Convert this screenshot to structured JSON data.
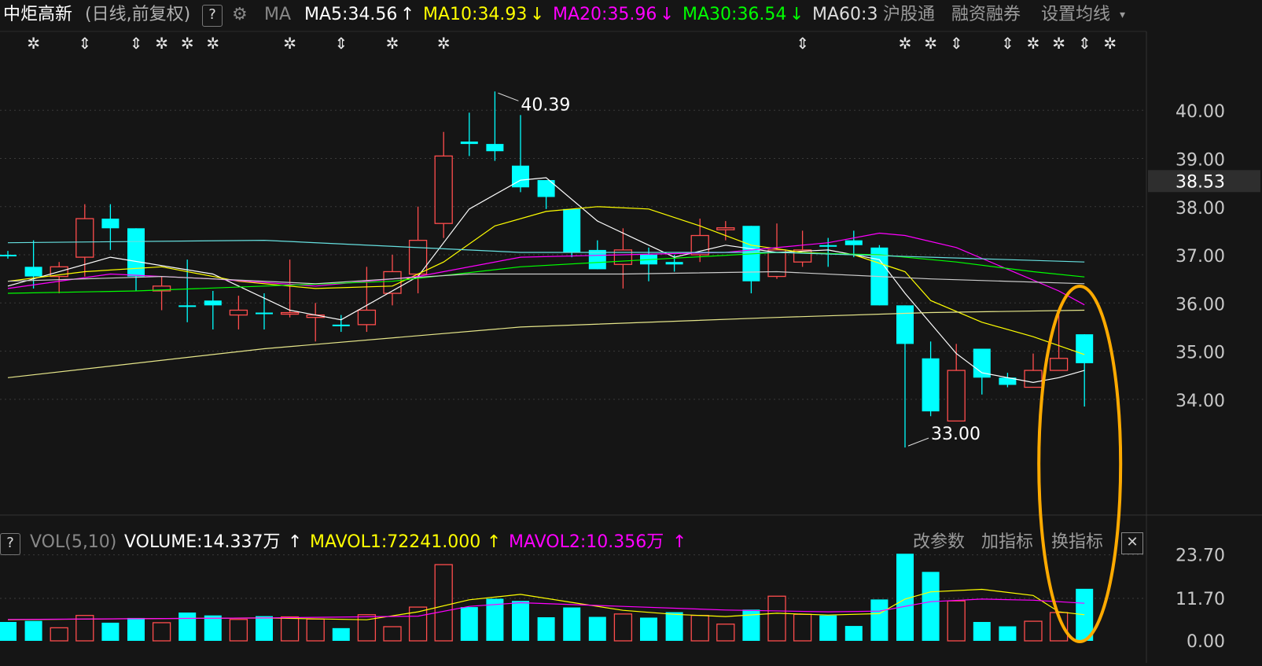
{
  "header": {
    "stock_name": "中炬高新",
    "period_label": "(日线,前复权)",
    "help_label": "?",
    "settings_icon": "gear-icon",
    "ma_label": "MA",
    "ma5": "MA5:34.56",
    "ma10": "MA10:34.93",
    "ma20": "MA20:35.96",
    "ma30": "MA30:36.54",
    "ma60": "MA60:3",
    "up_arrow": "↑",
    "down_arrow": "↓",
    "hsgt": "沪股通",
    "margin": "融资融券",
    "set_ma": "设置均线",
    "caret": "▾"
  },
  "volume_header": {
    "help_label": "?",
    "vol_label": "VOL(5,10)",
    "volume": "VOLUME:14.337万",
    "mavol1": "MAVOL1:72241.000",
    "mavol2": "MAVOL2:10.356万",
    "arrow": "↑",
    "edit_params": "改参数",
    "add_indicator": "加指标",
    "switch_indicator": "换指标",
    "close": "✕"
  },
  "colors": {
    "up": "#ff4d4d",
    "down": "#00ffff",
    "ma5": "#ffffff",
    "ma10": "#ffff00",
    "ma20": "#ff00ff",
    "ma30": "#00ff00",
    "ma60": "#cccccc",
    "highlight": "#ffaa00",
    "grid": "#3a3a3a"
  },
  "chart_data": {
    "type": "candlestick",
    "price_axis": {
      "ticks": [
        "40.00",
        "39.00",
        "38.00",
        "37.00",
        "36.00",
        "35.00",
        "34.00"
      ],
      "ylim": [
        32.3,
        40.95
      ]
    },
    "current_price": "38.53",
    "volume_axis": {
      "ticks": [
        "23.70",
        "11.70",
        "0.00"
      ],
      "ylim": [
        0,
        26
      ]
    },
    "annotations": {
      "high": "40.39",
      "low": "33.00"
    },
    "event_marker_glyph": {
      "star": "✲",
      "updown": "⇕"
    },
    "event_markers": [
      "star",
      "updown",
      "updown",
      "star",
      "star",
      "star",
      "star",
      "updown",
      "star",
      "star",
      "updown",
      "star",
      "star",
      "updown",
      "updown",
      "star",
      "star",
      "updown",
      "star"
    ],
    "candles": [
      {
        "o": 37.0,
        "c": 37.0,
        "h": 37.08,
        "l": 36.92,
        "dir": "down",
        "vol": 5.2
      },
      {
        "o": 36.75,
        "c": 36.55,
        "h": 37.3,
        "l": 36.3,
        "dir": "down",
        "vol": 5.5
      },
      {
        "o": 36.55,
        "c": 36.75,
        "h": 36.85,
        "l": 36.2,
        "dir": "up",
        "vol": 3.6
      },
      {
        "o": 36.95,
        "c": 37.75,
        "h": 38.05,
        "l": 36.55,
        "dir": "up",
        "vol": 7.0
      },
      {
        "o": 37.75,
        "c": 37.55,
        "h": 38.05,
        "l": 37.1,
        "dir": "down",
        "vol": 5.0
      },
      {
        "o": 37.55,
        "c": 36.55,
        "h": 37.55,
        "l": 36.25,
        "dir": "down",
        "vol": 6.3
      },
      {
        "o": 36.25,
        "c": 36.35,
        "h": 36.55,
        "l": 35.85,
        "dir": "up",
        "vol": 5.0
      },
      {
        "o": 35.95,
        "c": 35.95,
        "h": 36.9,
        "l": 35.6,
        "dir": "down",
        "vol": 7.8
      },
      {
        "o": 36.05,
        "c": 35.95,
        "h": 36.25,
        "l": 35.45,
        "dir": "down",
        "vol": 7.0
      },
      {
        "o": 35.75,
        "c": 35.85,
        "h": 36.15,
        "l": 35.45,
        "dir": "up",
        "vol": 5.9
      },
      {
        "o": 35.8,
        "c": 35.8,
        "h": 36.2,
        "l": 35.45,
        "dir": "down",
        "vol": 6.8
      },
      {
        "o": 35.8,
        "c": 35.8,
        "h": 36.9,
        "l": 35.7,
        "dir": "up",
        "vol": 6.6
      },
      {
        "o": 35.7,
        "c": 35.75,
        "h": 36.0,
        "l": 35.2,
        "dir": "up",
        "vol": 6.0
      },
      {
        "o": 35.55,
        "c": 35.55,
        "h": 35.75,
        "l": 35.4,
        "dir": "down",
        "vol": 3.5
      },
      {
        "o": 35.55,
        "c": 35.85,
        "h": 36.75,
        "l": 35.4,
        "dir": "up",
        "vol": 7.2
      },
      {
        "o": 36.2,
        "c": 36.65,
        "h": 37.0,
        "l": 35.95,
        "dir": "up",
        "vol": 3.9
      },
      {
        "o": 36.6,
        "c": 37.3,
        "h": 38.0,
        "l": 36.2,
        "dir": "up",
        "vol": 9.3
      },
      {
        "o": 37.65,
        "c": 39.05,
        "h": 39.55,
        "l": 37.35,
        "dir": "up",
        "vol": 21.0
      },
      {
        "o": 39.35,
        "c": 39.3,
        "h": 39.95,
        "l": 39.05,
        "dir": "down",
        "vol": 9.3
      },
      {
        "o": 39.3,
        "c": 39.15,
        "h": 40.39,
        "l": 38.95,
        "dir": "down",
        "vol": 11.6
      },
      {
        "o": 38.85,
        "c": 38.4,
        "h": 39.9,
        "l": 38.3,
        "dir": "down",
        "vol": 11.0
      },
      {
        "o": 38.55,
        "c": 38.2,
        "h": 38.55,
        "l": 37.95,
        "dir": "down",
        "vol": 6.5
      },
      {
        "o": 37.95,
        "c": 37.05,
        "h": 37.95,
        "l": 36.95,
        "dir": "down",
        "vol": 9.2
      },
      {
        "o": 37.1,
        "c": 36.7,
        "h": 37.3,
        "l": 36.7,
        "dir": "down",
        "vol": 6.6
      },
      {
        "o": 36.8,
        "c": 37.1,
        "h": 37.55,
        "l": 36.3,
        "dir": "up",
        "vol": 7.4
      },
      {
        "o": 37.0,
        "c": 36.8,
        "h": 37.15,
        "l": 36.45,
        "dir": "down",
        "vol": 6.4
      },
      {
        "o": 36.85,
        "c": 36.8,
        "h": 37.0,
        "l": 36.65,
        "dir": "down",
        "vol": 7.9
      },
      {
        "o": 37.0,
        "c": 37.4,
        "h": 37.75,
        "l": 36.85,
        "dir": "up",
        "vol": 7.0
      },
      {
        "o": 37.52,
        "c": 37.56,
        "h": 37.7,
        "l": 37.3,
        "dir": "up",
        "vol": 4.6
      },
      {
        "o": 37.6,
        "c": 36.45,
        "h": 37.6,
        "l": 36.2,
        "dir": "down",
        "vol": 8.6
      },
      {
        "o": 36.55,
        "c": 37.1,
        "h": 37.65,
        "l": 36.5,
        "dir": "up",
        "vol": 12.3
      },
      {
        "o": 36.85,
        "c": 37.1,
        "h": 37.5,
        "l": 36.75,
        "dir": "up",
        "vol": 7.3
      },
      {
        "o": 37.2,
        "c": 37.2,
        "h": 37.35,
        "l": 36.75,
        "dir": "down",
        "vol": 7.0
      },
      {
        "o": 37.2,
        "c": 37.3,
        "h": 37.5,
        "l": 36.95,
        "dir": "down",
        "vol": 4.1
      },
      {
        "o": 37.15,
        "c": 35.95,
        "h": 37.2,
        "l": 35.95,
        "dir": "down",
        "vol": 11.4
      },
      {
        "o": 35.95,
        "c": 35.15,
        "h": 35.95,
        "l": 33.0,
        "dir": "down",
        "vol": 24.0
      },
      {
        "o": 34.85,
        "c": 33.75,
        "h": 35.2,
        "l": 33.65,
        "dir": "down",
        "vol": 19.0
      },
      {
        "o": 33.55,
        "c": 34.6,
        "h": 35.15,
        "l": 33.55,
        "dir": "up",
        "vol": 11.0
      },
      {
        "o": 35.05,
        "c": 34.45,
        "h": 35.05,
        "l": 34.1,
        "dir": "down",
        "vol": 5.2
      },
      {
        "o": 34.45,
        "c": 34.3,
        "h": 34.55,
        "l": 34.25,
        "dir": "down",
        "vol": 4.0
      },
      {
        "o": 34.25,
        "c": 34.6,
        "h": 34.95,
        "l": 34.25,
        "dir": "up",
        "vol": 5.4
      },
      {
        "o": 34.6,
        "c": 34.85,
        "h": 35.75,
        "l": 34.6,
        "dir": "up",
        "vol": 7.8
      },
      {
        "o": 35.35,
        "c": 34.75,
        "h": 35.35,
        "l": 33.85,
        "dir": "down",
        "vol": 14.337
      }
    ],
    "ma_series": [
      {
        "name": "MA5",
        "color": "#ffffff",
        "points": [
          [
            0,
            36.35
          ],
          [
            4,
            36.95
          ],
          [
            8,
            36.6
          ],
          [
            11,
            35.85
          ],
          [
            13,
            35.65
          ],
          [
            16,
            36.55
          ],
          [
            18,
            37.95
          ],
          [
            20,
            38.55
          ],
          [
            21,
            38.6
          ],
          [
            23,
            37.7
          ],
          [
            25,
            37.2
          ],
          [
            26,
            36.95
          ],
          [
            28,
            37.2
          ],
          [
            30,
            37.05
          ],
          [
            32,
            37.1
          ],
          [
            34,
            36.9
          ],
          [
            35,
            36.2
          ],
          [
            37,
            34.95
          ],
          [
            38,
            34.55
          ],
          [
            40,
            34.35
          ],
          [
            41,
            34.45
          ],
          [
            42,
            34.6
          ]
        ]
      },
      {
        "name": "MA10",
        "color": "#ffff00",
        "points": [
          [
            0,
            36.45
          ],
          [
            3,
            36.65
          ],
          [
            6,
            36.75
          ],
          [
            9,
            36.45
          ],
          [
            12,
            36.3
          ],
          [
            15,
            36.35
          ],
          [
            17,
            36.85
          ],
          [
            19,
            37.6
          ],
          [
            21,
            37.9
          ],
          [
            23,
            38.0
          ],
          [
            25,
            37.95
          ],
          [
            27,
            37.6
          ],
          [
            29,
            37.2
          ],
          [
            31,
            37.05
          ],
          [
            33,
            37.0
          ],
          [
            35,
            36.65
          ],
          [
            36,
            36.05
          ],
          [
            38,
            35.6
          ],
          [
            40,
            35.3
          ],
          [
            42,
            34.93
          ]
        ]
      },
      {
        "name": "MA20",
        "color": "#ff00ff",
        "points": [
          [
            0,
            36.3
          ],
          [
            4,
            36.6
          ],
          [
            8,
            36.5
          ],
          [
            12,
            36.35
          ],
          [
            16,
            36.55
          ],
          [
            20,
            36.95
          ],
          [
            24,
            37.0
          ],
          [
            28,
            37.05
          ],
          [
            32,
            37.25
          ],
          [
            34,
            37.45
          ],
          [
            35,
            37.4
          ],
          [
            37,
            37.15
          ],
          [
            39,
            36.7
          ],
          [
            41,
            36.25
          ],
          [
            42,
            35.96
          ]
        ]
      },
      {
        "name": "MA30",
        "color": "#00ff00",
        "points": [
          [
            0,
            36.2
          ],
          [
            5,
            36.25
          ],
          [
            10,
            36.35
          ],
          [
            15,
            36.45
          ],
          [
            20,
            36.75
          ],
          [
            25,
            36.9
          ],
          [
            30,
            37.05
          ],
          [
            34,
            37.0
          ],
          [
            37,
            36.85
          ],
          [
            40,
            36.65
          ],
          [
            42,
            36.54
          ]
        ]
      },
      {
        "name": "MA60",
        "color": "#cccccc",
        "points": [
          [
            0,
            36.45
          ],
          [
            6,
            36.55
          ],
          [
            12,
            36.4
          ],
          [
            18,
            36.6
          ],
          [
            24,
            36.6
          ],
          [
            30,
            36.65
          ],
          [
            36,
            36.5
          ],
          [
            42,
            36.4
          ]
        ]
      },
      {
        "name": "MA120",
        "color": "#66e0e0",
        "points": [
          [
            0,
            37.25
          ],
          [
            10,
            37.3
          ],
          [
            20,
            37.05
          ],
          [
            30,
            37.05
          ],
          [
            36,
            36.95
          ],
          [
            42,
            36.85
          ]
        ]
      },
      {
        "name": "MA250",
        "color": "#e6e68a",
        "points": [
          [
            0,
            34.45
          ],
          [
            10,
            35.05
          ],
          [
            20,
            35.5
          ],
          [
            30,
            35.7
          ],
          [
            36,
            35.8
          ],
          [
            42,
            35.85
          ]
        ]
      }
    ],
    "vol_ma_series": [
      {
        "name": "MAVOL1",
        "color": "#ffff00",
        "points": [
          [
            0,
            5.8
          ],
          [
            5,
            6.1
          ],
          [
            10,
            6.3
          ],
          [
            14,
            5.8
          ],
          [
            16,
            8.0
          ],
          [
            18,
            11.3
          ],
          [
            20,
            12.8
          ],
          [
            22,
            10.6
          ],
          [
            24,
            8.4
          ],
          [
            26,
            7.3
          ],
          [
            28,
            6.7
          ],
          [
            30,
            7.6
          ],
          [
            32,
            7.1
          ],
          [
            34,
            7.5
          ],
          [
            35,
            11.5
          ],
          [
            36,
            13.5
          ],
          [
            38,
            14.2
          ],
          [
            40,
            12.5
          ],
          [
            41,
            8.0
          ],
          [
            42,
            7.2
          ]
        ]
      },
      {
        "name": "MAVOL2",
        "color": "#ff00ff",
        "points": [
          [
            0,
            5.9
          ],
          [
            10,
            6.3
          ],
          [
            16,
            6.8
          ],
          [
            18,
            9.5
          ],
          [
            20,
            10.5
          ],
          [
            24,
            9.5
          ],
          [
            28,
            8.5
          ],
          [
            32,
            8.0
          ],
          [
            34,
            8.2
          ],
          [
            36,
            10.8
          ],
          [
            38,
            11.5
          ],
          [
            40,
            11.2
          ],
          [
            42,
            10.356
          ]
        ]
      }
    ]
  }
}
